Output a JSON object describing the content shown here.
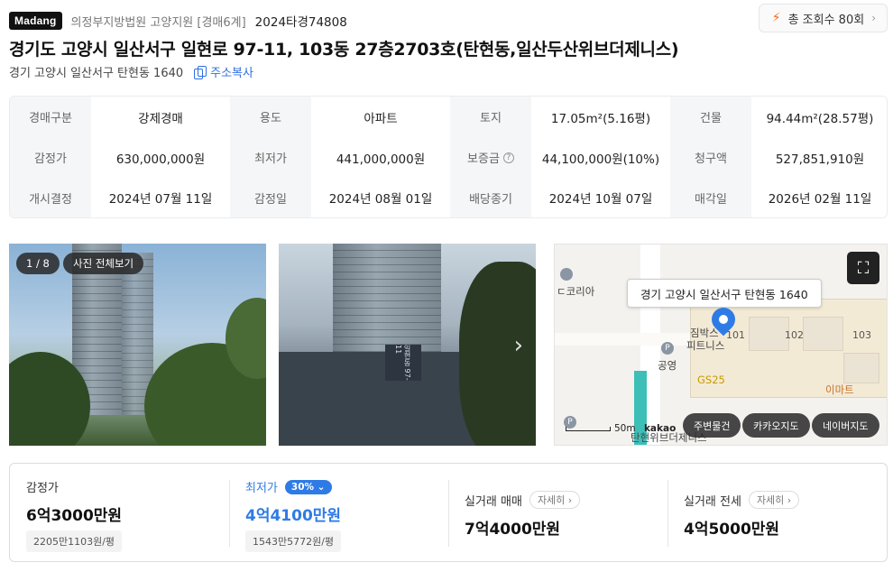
{
  "header": {
    "logo": "Madang",
    "court": "의정부지방법원 고양지원 [경매6계]",
    "case_no": "2024타경74808",
    "views": "총 조회수 80회"
  },
  "property": {
    "title": "경기도 고양시 일산서구 일현로 97-11, 103동 27층2703호(탄현동,일산두산위브더제니스)",
    "lot_address": "경기 고양시 일산서구 탄현동 1640",
    "copy_label": "주소복사"
  },
  "info": {
    "rows": [
      [
        {
          "k": "경매구분",
          "v": "강제경매"
        },
        {
          "k": "용도",
          "v": "아파트"
        },
        {
          "k": "토지",
          "v": "17.05m²(5.16평)"
        },
        {
          "k": "건물",
          "v": "94.44m²(28.57평)"
        }
      ],
      [
        {
          "k": "감정가",
          "v": "630,000,000원"
        },
        {
          "k": "최저가",
          "v": "441,000,000원"
        },
        {
          "k": "보증금",
          "v": "44,100,000원(10%)"
        },
        {
          "k": "청구액",
          "v": "527,851,910원"
        }
      ],
      [
        {
          "k": "개시결정",
          "v": "2024년 07월 11일"
        },
        {
          "k": "감정일",
          "v": "2024년 08월 01일"
        },
        {
          "k": "배당종기",
          "v": "2024년 10월 07일"
        },
        {
          "k": "매각일",
          "v": "2026년 02월 11일"
        }
      ]
    ],
    "help_glyph": "?"
  },
  "photos": {
    "counter": "1 / 8",
    "view_all": "사진 전체보기",
    "sign_text": "일현동 97-11",
    "next_glyph": "›"
  },
  "map": {
    "address_tip": "경기 고양시 일산서구 탄현동 1640",
    "labels": {
      "korea": "ㄷ코리아",
      "gym": "짐박스",
      "fitness": "피트니스",
      "gongyeong": "공영",
      "gs25": "GS25",
      "zenith": "탄현위브더제니스",
      "b101": "101",
      "b102": "102",
      "b103": "103",
      "emart": "이마트"
    },
    "scale": "50m",
    "kakao": "kakao",
    "buttons": {
      "nearby": "주변물건",
      "kakao_map": "카카오지도",
      "naver_map": "네이버지도"
    }
  },
  "prices": {
    "appraisal": {
      "label": "감정가",
      "value": "6억3000만원",
      "per_pyeong": "2205만1103원/평"
    },
    "minimum": {
      "label": "최저가",
      "pct": "30%",
      "value": "4억4100만원",
      "per_pyeong": "1543만5772원/평"
    },
    "real_sale": {
      "label": "실거래 매매",
      "detail": "자세히",
      "value": "7억4000만원"
    },
    "real_jeonse": {
      "label": "실거래 전세",
      "detail": "자세히",
      "value": "4억5000만원"
    }
  },
  "colors": {
    "accent": "#2f7be6",
    "bolt": "#f26a1b"
  }
}
